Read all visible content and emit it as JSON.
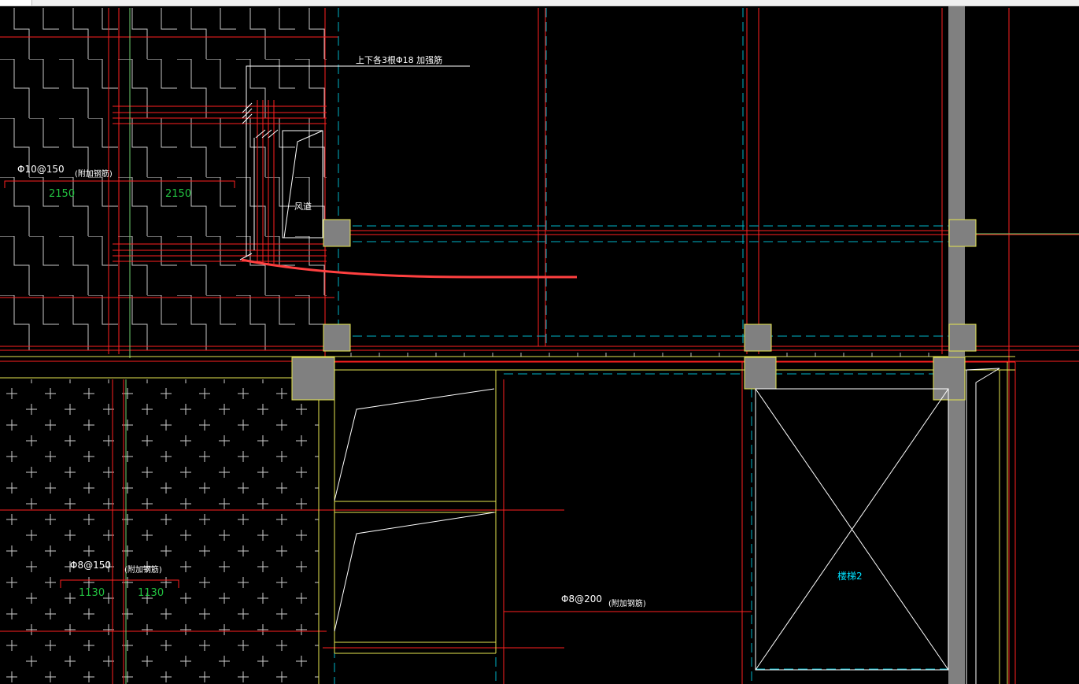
{
  "labels": {
    "rebar_note_top": "上下各3根Φ18 加强筋",
    "rebar_left_top": "Φ10@150",
    "note_left_top": "(附加钢筋)",
    "dim_left_a": "2150",
    "dim_left_b": "2150",
    "shaft_label": "风道",
    "rebar_left_bottom": "Φ8@150",
    "note_left_bottom": "(附加钢筋)",
    "dim_bottom_a": "1130",
    "dim_bottom_b": "1130",
    "rebar_middle": "Φ8@200",
    "note_middle": "(附加钢筋)",
    "stair_label": "楼梯2"
  },
  "colors": {
    "background": "#000000",
    "rebar_red": "#ff2020",
    "grid_cyan": "#00b4c8",
    "wall_yellow": "#e6e650",
    "outline_white": "#ffffff",
    "column_gray": "#808080",
    "dim_green": "#22c040",
    "guide_green": "#70d070",
    "stair_cyan": "#00e0ff"
  }
}
